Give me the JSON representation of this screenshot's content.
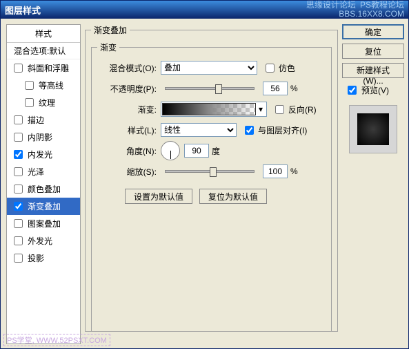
{
  "titlebar": {
    "title": "图层样式",
    "watermark_top": "思缘设计论坛",
    "watermark_sub": "BBS.16XX8.COM",
    "ps_wm": "PS教程论坛"
  },
  "left": {
    "header": "样式",
    "sub": "混合选项:默认",
    "items": [
      {
        "label": "斜面和浮雕",
        "checked": false,
        "indent": 0
      },
      {
        "label": "等高线",
        "checked": false,
        "indent": 1
      },
      {
        "label": "纹理",
        "checked": false,
        "indent": 1
      },
      {
        "label": "描边",
        "checked": false,
        "indent": 0
      },
      {
        "label": "内阴影",
        "checked": false,
        "indent": 0
      },
      {
        "label": "内发光",
        "checked": true,
        "indent": 0
      },
      {
        "label": "光泽",
        "checked": false,
        "indent": 0
      },
      {
        "label": "颜色叠加",
        "checked": false,
        "indent": 0
      },
      {
        "label": "渐变叠加",
        "checked": true,
        "indent": 0,
        "selected": true
      },
      {
        "label": "图案叠加",
        "checked": false,
        "indent": 0
      },
      {
        "label": "外发光",
        "checked": false,
        "indent": 0
      },
      {
        "label": "投影",
        "checked": false,
        "indent": 0
      }
    ]
  },
  "center": {
    "group_title": "渐变叠加",
    "inner_title": "渐变",
    "blend_label": "混合模式(O):",
    "blend_value": "叠加",
    "dither_label": "仿色",
    "dither_checked": false,
    "opacity_label": "不透明度(P):",
    "opacity_value": "56",
    "opacity_unit": "%",
    "gradient_label": "渐变:",
    "reverse_label": "反向(R)",
    "reverse_checked": false,
    "style_label": "样式(L):",
    "style_value": "线性",
    "align_label": "与图层对齐(I)",
    "align_checked": true,
    "angle_label": "角度(N):",
    "angle_value": "90",
    "angle_unit": "度",
    "scale_label": "缩放(S):",
    "scale_value": "100",
    "scale_unit": "%",
    "btn_default": "设置为默认值",
    "btn_reset": "复位为默认值"
  },
  "right": {
    "ok": "确定",
    "reset": "复位",
    "newstyle": "新建样式(W)...",
    "preview_label": "预览(V)",
    "preview_checked": true
  },
  "footer": {
    "wm": "PS学堂, WWW.52PSXT.COM"
  }
}
